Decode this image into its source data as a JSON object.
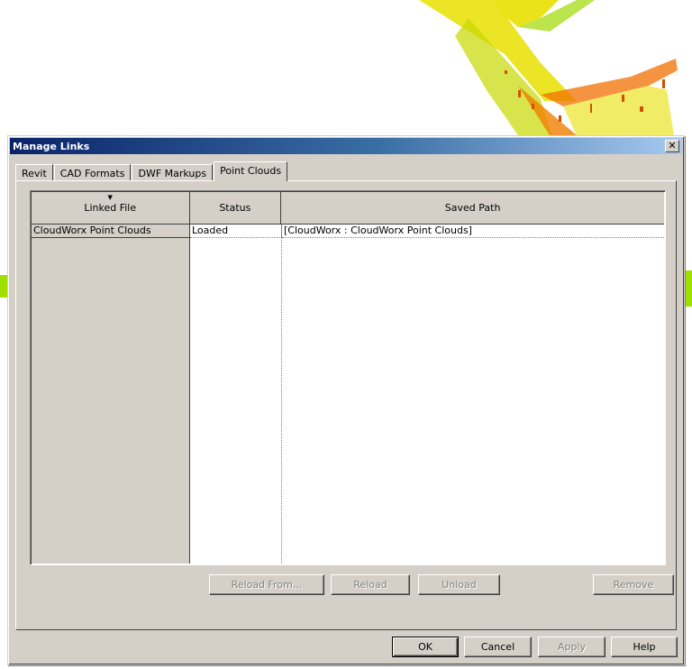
{
  "dialog": {
    "title": "Manage Links",
    "close_label": "✕"
  },
  "tabs": [
    {
      "label": "Revit",
      "active": false
    },
    {
      "label": "CAD Formats",
      "active": false
    },
    {
      "label": "DWF Markups",
      "active": false
    },
    {
      "label": "Point Clouds",
      "active": true
    }
  ],
  "grid": {
    "columns": [
      "Linked File",
      "Status",
      "Saved Path"
    ],
    "sort_indicator": "▼",
    "rows": [
      {
        "linked_file": "CloudWorx Point Clouds",
        "status": "Loaded",
        "saved_path": "[CloudWorx : CloudWorx Point Clouds]"
      }
    ]
  },
  "panel_buttons": {
    "reload_from": "Reload From...",
    "reload": "Reload",
    "unload": "Unload",
    "remove": "Remove"
  },
  "footer_buttons": {
    "ok": "OK",
    "cancel": "Cancel",
    "apply": "Apply",
    "help": "Help"
  },
  "colors": {
    "dialog_bg": "#d4d0c8",
    "titlebar_start": "#0a246a",
    "titlebar_end": "#a6caf0",
    "cloud_yellow": "#e8e000",
    "cloud_orange": "#f07000",
    "cloud_green": "#90e000"
  }
}
